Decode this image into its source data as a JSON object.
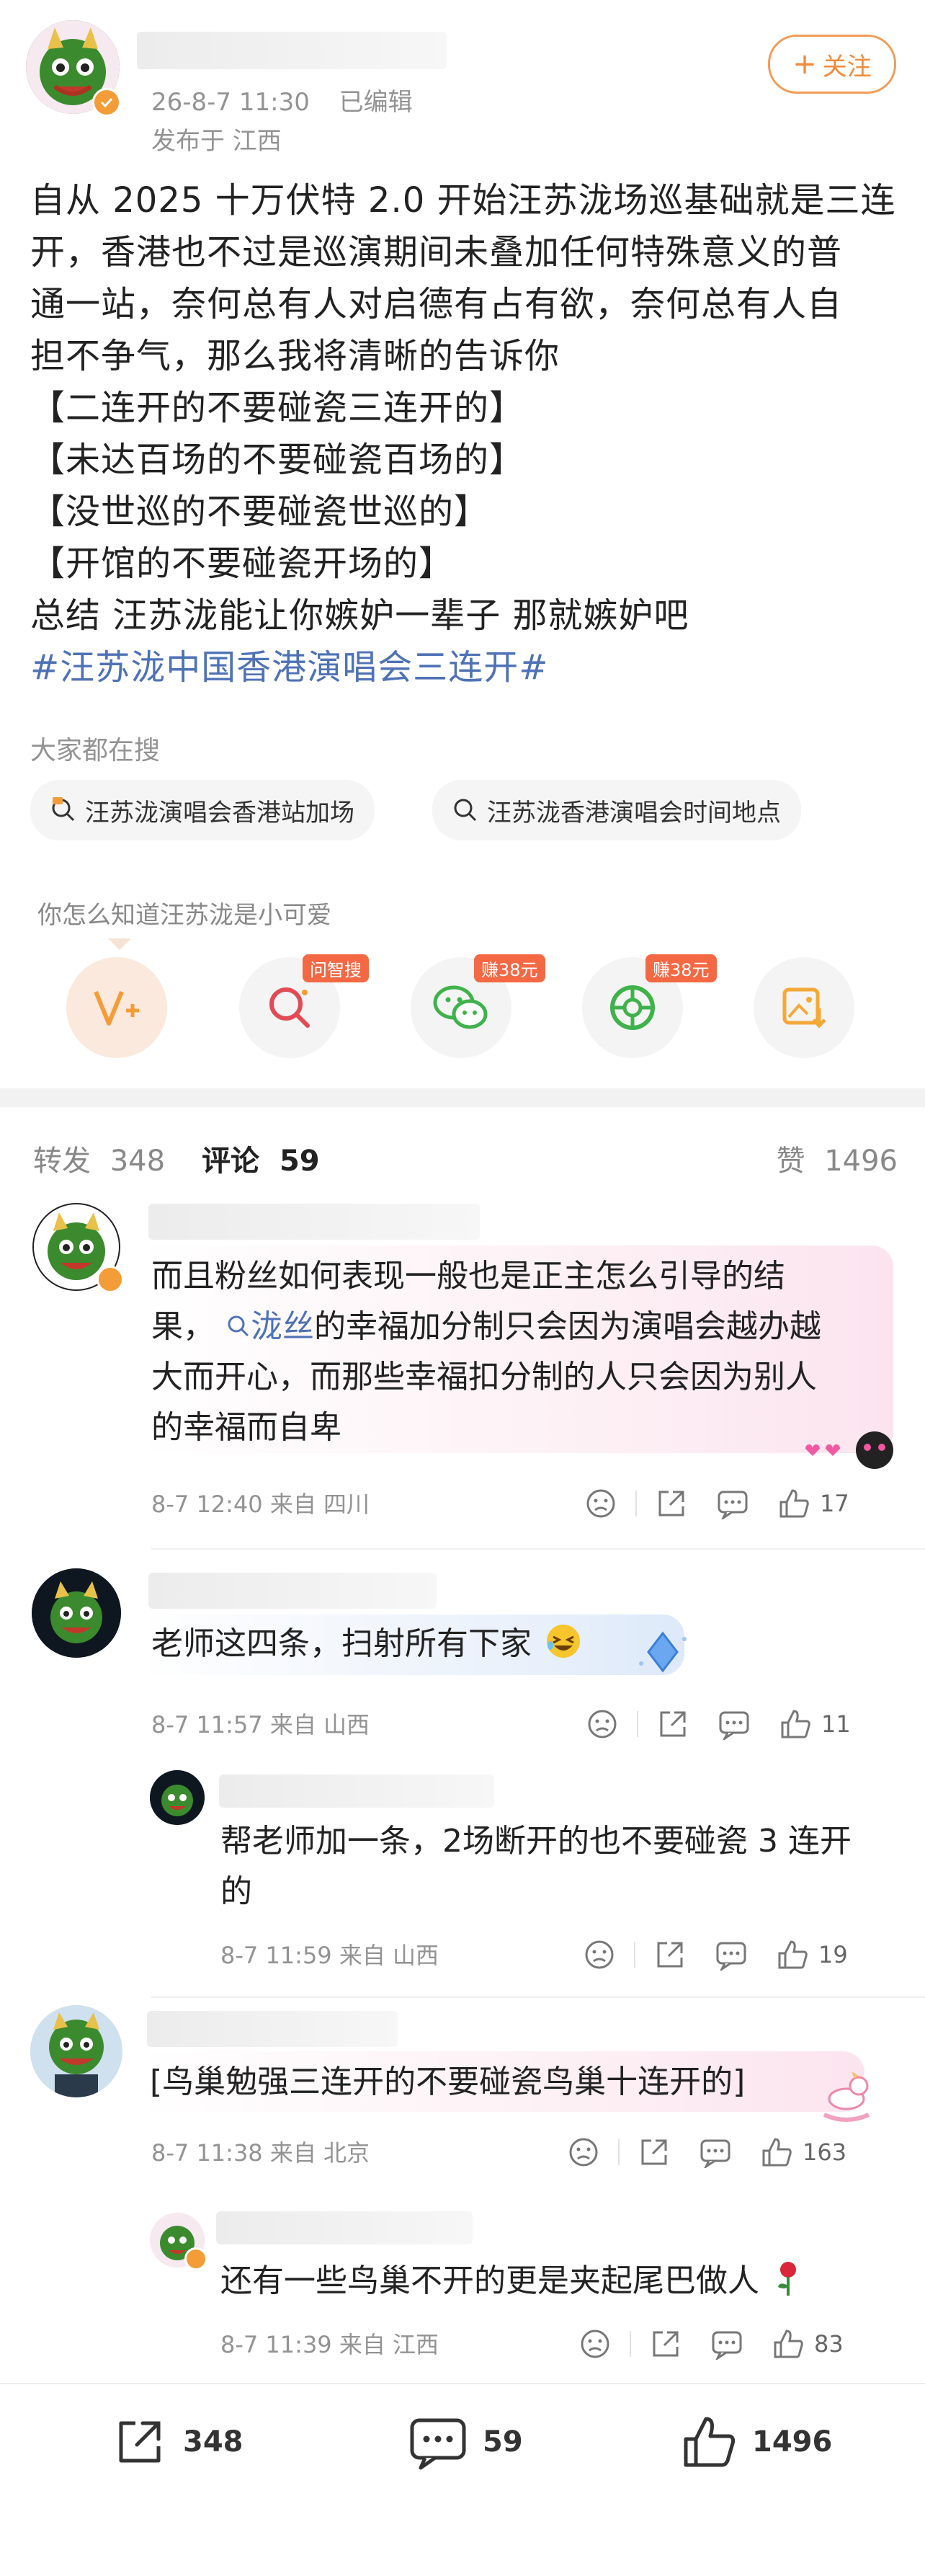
{
  "post": {
    "timestamp": "26-8-7 11:30",
    "edited": "已编辑",
    "location": "发布于 江西",
    "follow_label": "关注",
    "lines": [
      "自从 2025 十万伏特 2.0 开始汪苏泷场巡基础就是三连",
      "开，香港也不过是巡演期间未叠加任何特殊意义的普",
      "通一站，奈何总有人对启德有占有欲，奈何总有人自",
      "担不争气，那么我将清晰的告诉你",
      "【二连开的不要碰瓷三连开的】",
      "【未达百场的不要碰瓷百场的】",
      "【没世巡的不要碰瓷世巡的】",
      "【开馆的不要碰瓷开场的】",
      "总结 汪苏泷能让你嫉妒一辈子 那就嫉妒吧"
    ],
    "hashtag": "#汪苏泷中国香港演唱会三连开#"
  },
  "search": {
    "heading": "大家都在搜",
    "chips": [
      "汪苏泷演唱会香港站加场",
      "汪苏泷香港演唱会时间地点"
    ]
  },
  "prompt": "你怎么知道汪苏泷是小可爱",
  "share_actions": {
    "tags": [
      "问智搜",
      "赚38元",
      "赚38元"
    ]
  },
  "stats": {
    "repost_label": "转发",
    "repost_count": "348",
    "comment_label": "评论",
    "comment_count": "59",
    "like_label": "赞",
    "like_count": "1496"
  },
  "comments": [
    {
      "lines": [
        "而且粉丝如何表现一般也是正主怎么引导的结",
        "果，",
        "的幸福加分制只会因为演唱会越办越",
        "大而开心，而那些幸福扣分制的人只会因为别人",
        "的幸福而自卑"
      ],
      "search_word": "泷丝",
      "meta": "8-7 12:40  来自 四川",
      "likes": "17"
    },
    {
      "text": "老师这四条，扫射所有下家",
      "meta": "8-7 11:57  来自 山西",
      "likes": "11",
      "reply": {
        "lines": [
          "帮老师加一条，2场断开的也不要碰瓷 3 连开",
          "的"
        ],
        "meta": "8-7 11:59  来自 山西",
        "likes": "19"
      }
    },
    {
      "text": "[鸟巢勉强三连开的不要碰瓷鸟巢十连开的]",
      "meta": "8-7 11:38  来自 北京",
      "likes": "163",
      "reply": {
        "text": "还有一些鸟巢不开的更是夹起尾巴做人",
        "meta": "8-7 11:39  来自 江西",
        "likes": "83"
      }
    }
  ],
  "bottom_bar": {
    "repost": "348",
    "comment": "59",
    "like": "1496"
  },
  "colors": {
    "accent_orange": "#f18a3a",
    "hashtag_blue": "#4f72b6",
    "tag_red": "#f46844",
    "dragon_green": "#2f6b2a"
  }
}
